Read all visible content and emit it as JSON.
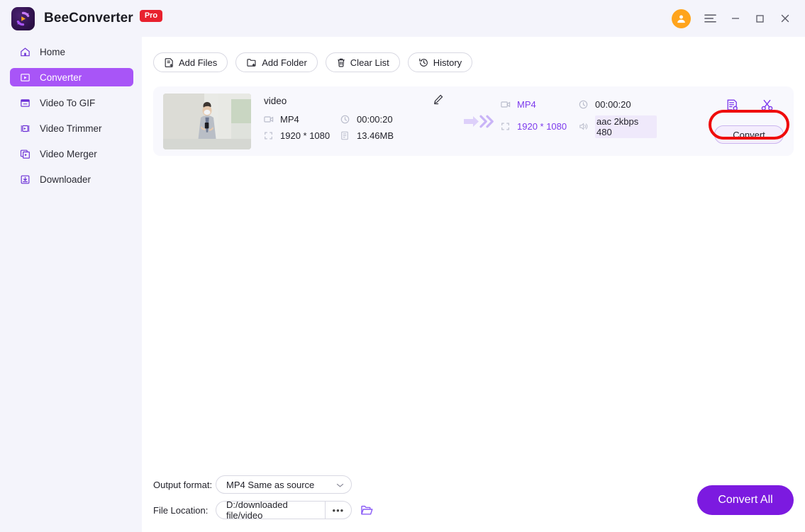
{
  "app": {
    "brand": "BeeConverter",
    "badge": "Pro",
    "logo_icon": "beeconverter-logo-icon"
  },
  "titlebar": {
    "account_icon": "account-avatar-icon",
    "menu_icon": "hamburger-menu-icon",
    "minimize_icon": "minimize-icon",
    "maximize_icon": "maximize-icon",
    "close_icon": "close-icon"
  },
  "sidebar": {
    "items": [
      {
        "label": "Home",
        "icon": "home-icon",
        "active": false
      },
      {
        "label": "Converter",
        "icon": "converter-icon",
        "active": true
      },
      {
        "label": "Video To GIF",
        "icon": "video-to-gif-icon",
        "active": false
      },
      {
        "label": "Video Trimmer",
        "icon": "video-trimmer-icon",
        "active": false
      },
      {
        "label": "Video Merger",
        "icon": "video-merger-icon",
        "active": false
      },
      {
        "label": "Downloader",
        "icon": "downloader-icon",
        "active": false
      }
    ]
  },
  "toolbar": {
    "add_files": "Add Files",
    "add_folder": "Add Folder",
    "clear_list": "Clear List",
    "history": "History"
  },
  "file": {
    "title": "video",
    "edit_icon": "edit-pencil-icon",
    "source": {
      "format": "MP4",
      "duration": "00:00:20",
      "resolution": "1920 * 1080",
      "size": "13.46MB"
    },
    "output": {
      "format": "MP4",
      "duration": "00:00:20",
      "resolution": "1920 * 1080",
      "audio": "aac 2kbps 480"
    },
    "settings_icon": "output-settings-icon",
    "trim_icon": "scissors-trim-icon",
    "convert_label": "Convert"
  },
  "footer": {
    "output_format_label": "Output format:",
    "output_format_value": "MP4 Same as source",
    "file_location_label": "File Location:",
    "file_location_value": "D:/downloaded file/video",
    "browse_dots": "•••",
    "folder_icon": "open-folder-icon",
    "convert_all": "Convert All"
  },
  "colors": {
    "accent": "#7c3aed",
    "sidebar_active": "#a855f7",
    "convert_all": "#7c1ae0",
    "annotation": "#ef0b0b",
    "badge": "#e8212e",
    "avatar": "#ffa41c"
  }
}
